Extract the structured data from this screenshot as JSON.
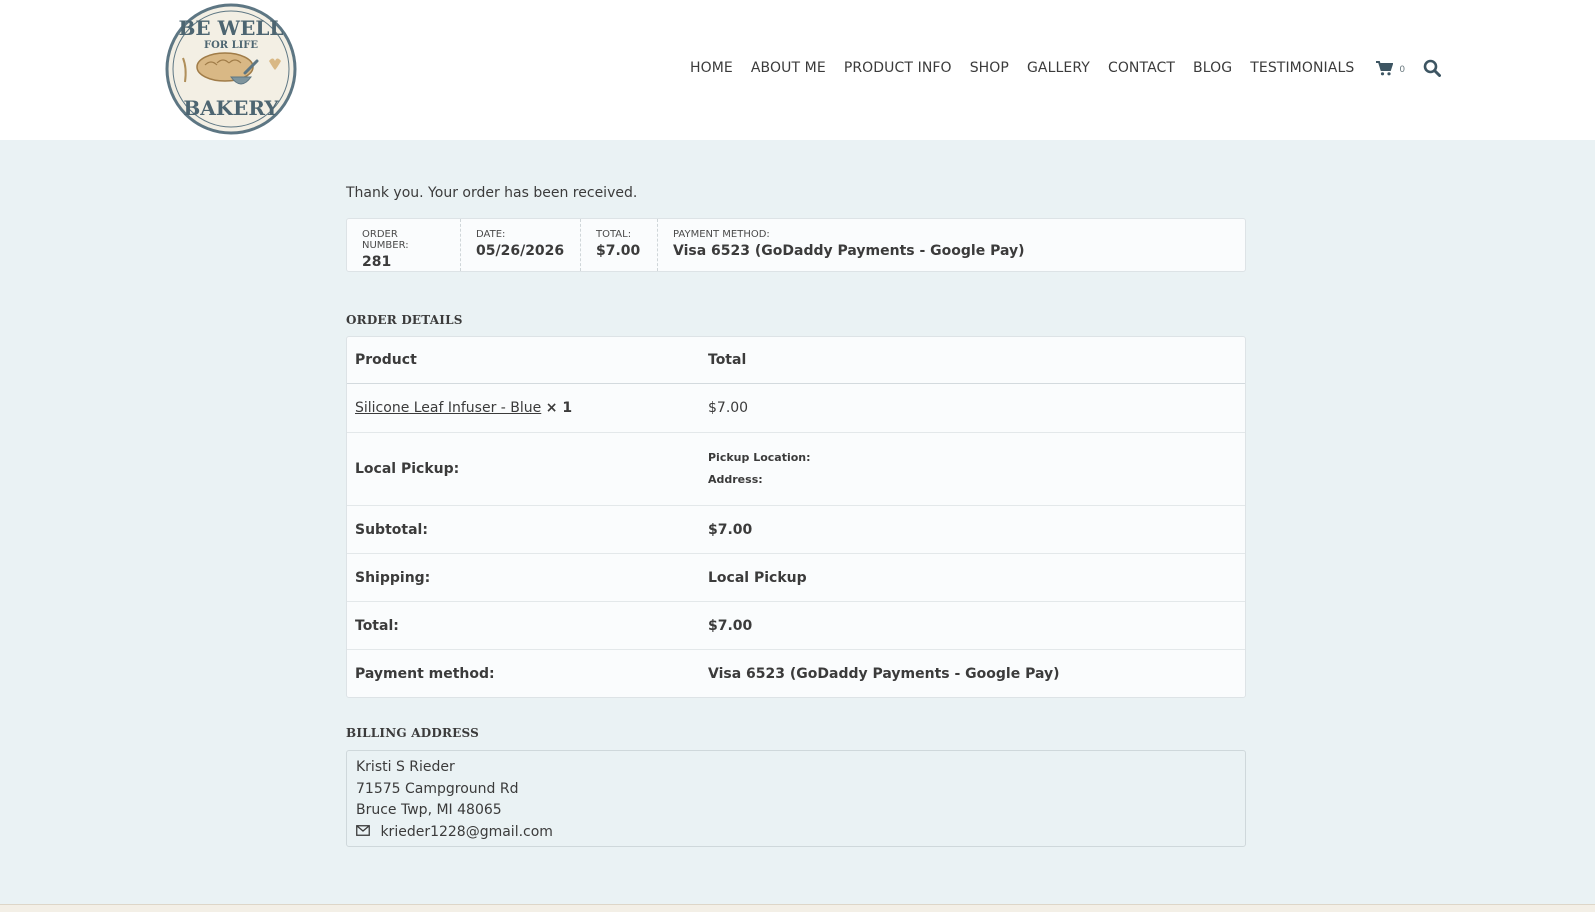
{
  "brand": {
    "logo_top": "BE WELL",
    "logo_middle": "FOR LIFE",
    "logo_bottom": "BAKERY"
  },
  "nav": {
    "items": [
      "HOME",
      "ABOUT ME",
      "PRODUCT INFO",
      "SHOP",
      "GALLERY",
      "CONTACT",
      "BLOG",
      "TESTIMONIALS"
    ],
    "cart_count": "0",
    "cart_icon": "cart-icon",
    "search_icon": "search-icon"
  },
  "order": {
    "thanks": "Thank you. Your order has been received.",
    "overview": {
      "number_label": "ORDER NUMBER:",
      "number": "281",
      "date_label": "DATE:",
      "date": "05/26/2026",
      "total_label": "TOTAL:",
      "total": "$7.00",
      "payment_label": "PAYMENT METHOD:",
      "payment": "Visa 6523 (GoDaddy Payments - Google Pay)"
    },
    "details_title": "ORDER DETAILS",
    "table": {
      "col_product": "Product",
      "col_total": "Total",
      "item_name": "Silicone Leaf Infuser - Blue",
      "item_qty": "× 1",
      "item_total": "$7.00",
      "pickup_label": "Local Pickup:",
      "pickup_location_label": "Pickup Location:",
      "pickup_address_label": "Address:",
      "subtotal_label": "Subtotal:",
      "subtotal": "$7.00",
      "shipping_label": "Shipping:",
      "shipping": "Local Pickup",
      "total_label": "Total:",
      "total": "$7.00",
      "payment_label": "Payment method:",
      "payment": "Visa 6523 (GoDaddy Payments - Google Pay)"
    },
    "billing_title": "BILLING ADDRESS",
    "billing": {
      "name": "Kristi S Rieder",
      "street": "71575 Campground Rd",
      "city": "Bruce Twp, MI 48065",
      "email": "krieder1228@gmail.com",
      "email_icon": "envelope-icon"
    }
  }
}
